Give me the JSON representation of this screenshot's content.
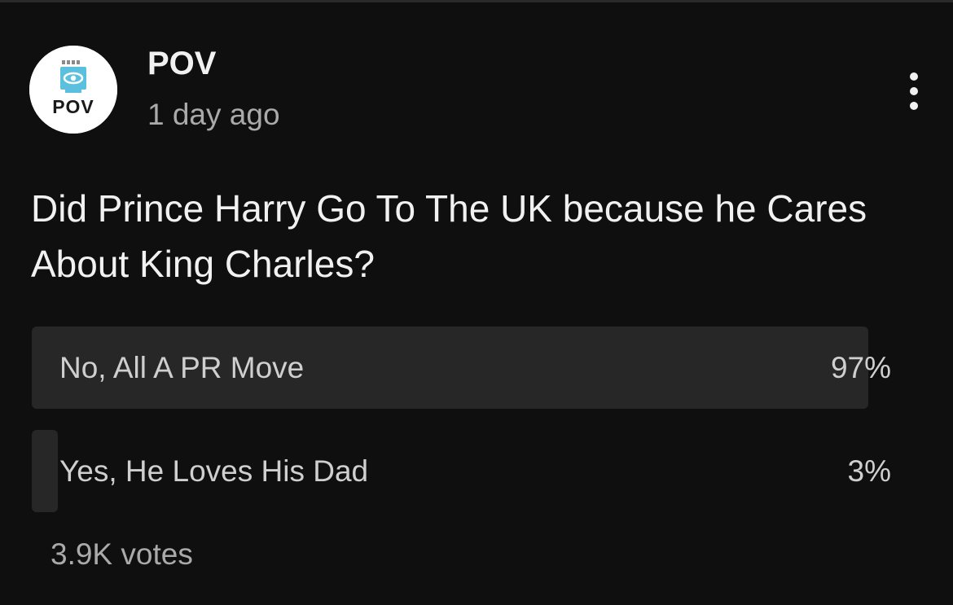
{
  "post": {
    "channel_name": "POV",
    "timestamp": "1 day ago",
    "avatar_text": "POV",
    "avatar_icon": "eye-logo-icon",
    "menu_icon": "more-vert-icon"
  },
  "poll": {
    "question": "Did Prince Harry Go To The UK because he Cares About King Charles?",
    "options": [
      {
        "label": "No, All A PR Move",
        "percent_text": "97%",
        "percent": 97
      },
      {
        "label": "Yes, He Loves His Dad",
        "percent_text": "3%",
        "percent": 3
      }
    ],
    "votes": "3.9K votes",
    "bar_color": "#272727"
  },
  "colors": {
    "background": "#0f0f0f",
    "text_primary": "#f1f1f1",
    "text_secondary": "#aaaaaa",
    "avatar_accent": "#5bc0de"
  }
}
